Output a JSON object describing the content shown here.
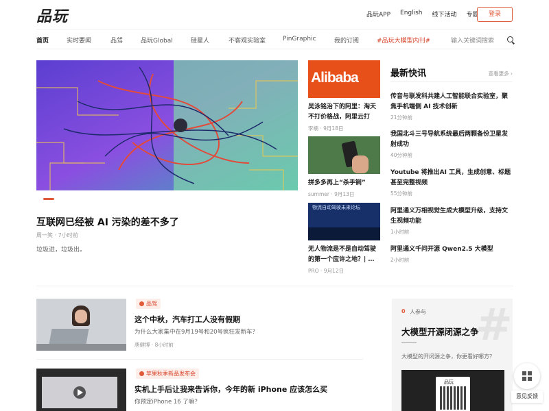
{
  "header": {
    "logo": "品玩",
    "links": [
      "品玩APP",
      "English",
      "线下活动",
      "专题"
    ],
    "login": "登录"
  },
  "nav": {
    "items": [
      "首页",
      "实时要闻",
      "品驾",
      "品玩Global",
      "硅星人",
      "不客观实验室",
      "PinGraphic",
      "我的订阅",
      "#品玩大模型内刊#"
    ],
    "search_placeholder": "输入关键词搜索"
  },
  "hero": {
    "title": "互联网已经被 AI 污染的差不多了",
    "meta": "周一笑 · 7小时前",
    "desc": "垃圾进，垃圾出。"
  },
  "mid": [
    {
      "title": "吴泳铭治下的阿里：淘天不打价格战，阿里云打",
      "meta": "李楠 · 9月18日",
      "img_text": "Alibaba"
    },
    {
      "title": "拼多多再上“杀手锏”",
      "meta": "summer · 9月13日"
    },
    {
      "title": "无人物流是不是自动驾驶的第一个应许之地？| …",
      "meta": "PRO · 9月12日",
      "img_text": "物流自动驾驶未来论坛"
    }
  ],
  "flash": {
    "title": "最新快讯",
    "more": "查看更多",
    "items": [
      {
        "title": "传音与联发科共建人工智能联合实验室，聚焦手机端侧 AI 技术创新",
        "time": "21分钟前"
      },
      {
        "title": "我国北斗三号导航系统最后两颗备份卫星发射成功",
        "time": "40分钟前"
      },
      {
        "title": "Youtube 将推出AI 工具，生成创意、标题甚至完整视频",
        "time": "55分钟前"
      },
      {
        "title": "阿里通义万相视觉生成大模型升级，支持文生视频功能",
        "time": "1小时前"
      },
      {
        "title": "阿里通义千问开源 Qwen2.5 大模型",
        "time": "2小时前"
      }
    ]
  },
  "list": [
    {
      "tag": "品驾",
      "title": "这个中秋，汽车打工人没有假期",
      "desc": "为什么大家集中在9月19号和20号疯狂发新车？",
      "meta": "唐健博 · 8小时前"
    },
    {
      "tag": "苹果秋季新品发布会",
      "title": "实机上手后让我来告诉你，今年的新 iPhone 应该怎么买",
      "desc": "你预定iPhone 16 了嘛？",
      "meta": ""
    }
  ],
  "topic": {
    "num": "0",
    "count": "人参与",
    "title": "大模型开源闭源之争",
    "desc": "大模型的开闭源之争，你更看好哪方？",
    "qr_text": "品玩"
  },
  "feedback": "意见反馈"
}
